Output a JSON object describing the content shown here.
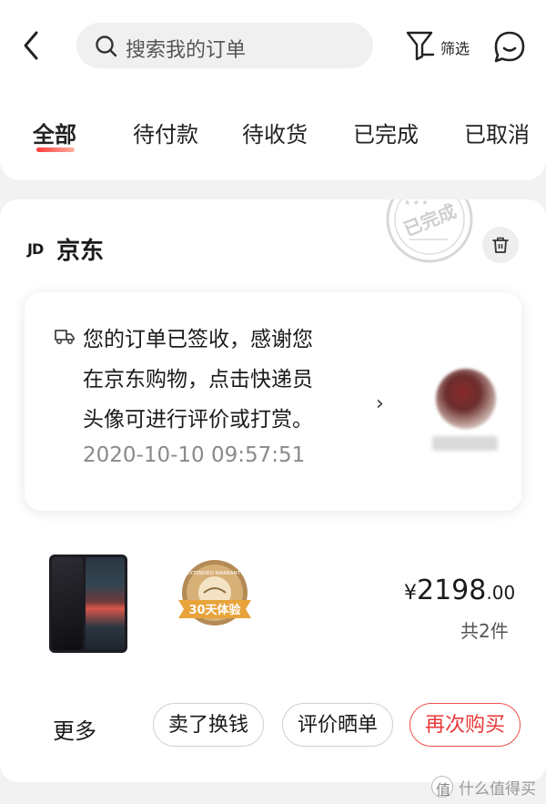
{
  "header": {
    "search_placeholder": "搜索我的订单",
    "filter_label": "筛选"
  },
  "tabs": [
    {
      "label": "全部",
      "active": true
    },
    {
      "label": "待付款",
      "active": false
    },
    {
      "label": "待收货",
      "active": false
    },
    {
      "label": "已完成",
      "active": false
    },
    {
      "label": "已取消",
      "active": false
    }
  ],
  "order": {
    "shop_logo": "JD",
    "shop_name": "京东",
    "stamp_text": "已完成",
    "notice": {
      "line1": "您的订单已签收，感谢您",
      "line2": "在京东购物，点击快递员",
      "line3": "头像可进行评价或打赏。",
      "time": "2020-10-10 09:57:51"
    },
    "product": {
      "badge_top": "EXTENDED WARRANTY",
      "badge_label": "30天体验",
      "price_symbol": "¥",
      "price_int": "2198",
      "price_dec": ".00",
      "count": "共2件"
    },
    "actions": {
      "more": "更多",
      "sell": "卖了换钱",
      "review": "评价晒单",
      "rebuy": "再次购买"
    }
  },
  "watermark": {
    "icon": "值",
    "text": "什么值得买"
  },
  "colors": {
    "accent": "#e83a3a",
    "tab_underline": "#ff3b3b",
    "badge": "#e8a33a"
  }
}
